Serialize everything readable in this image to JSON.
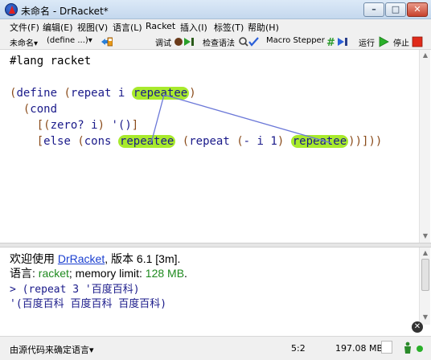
{
  "window": {
    "title": "未命名 - DrRacket*"
  },
  "menu": [
    {
      "label": "文件(F)"
    },
    {
      "label": "编辑(E)"
    },
    {
      "label": "视图(V)"
    },
    {
      "label": "语言(L)"
    },
    {
      "label": "Racket"
    },
    {
      "label": "插入(I)"
    },
    {
      "label": "标签(T)"
    },
    {
      "label": "帮助(H)"
    }
  ],
  "toolbar": {
    "file_menu": "未命名▾",
    "define_menu": "(define ...)▾",
    "debug_label": "调试",
    "check_syntax_label": "检查语法",
    "macro_stepper_label": "Macro Stepper",
    "run_label": "运行",
    "stop_label": "停止"
  },
  "definitions": {
    "lines": [
      "#lang racket",
      "",
      "(define (repeat i repeatee)",
      "  (cond",
      "    [(zero? i) '()]",
      "    [else (cons repeatee (repeat (- i 1) repeatee))]))"
    ],
    "highlighted_identifier": "repeatee"
  },
  "interactions": {
    "welcome_prefix": "欢迎使用 ",
    "welcome_link": "DrRacket",
    "welcome_suffix": ", 版本 ",
    "version": "6.1 [3m].",
    "language_prefix": "语言: ",
    "language": "racket",
    "memory_prefix": "; memory limit: ",
    "memory_limit": "128 MB",
    "memory_suffix": ".",
    "input": "> (repeat 3 '百度百科)",
    "output": "'(百度百科 百度百科 百度百科)"
  },
  "status": {
    "language_selector": "由源代码来确定语言▾",
    "position": "5:2",
    "memory_used": "197.08 MB"
  },
  "colors": {
    "highlight": "#a8ea2c",
    "arrow": "#6b78d8",
    "keyword": "#1a1a8a",
    "link": "#1a3fd0",
    "language": "#1f8a1f"
  }
}
